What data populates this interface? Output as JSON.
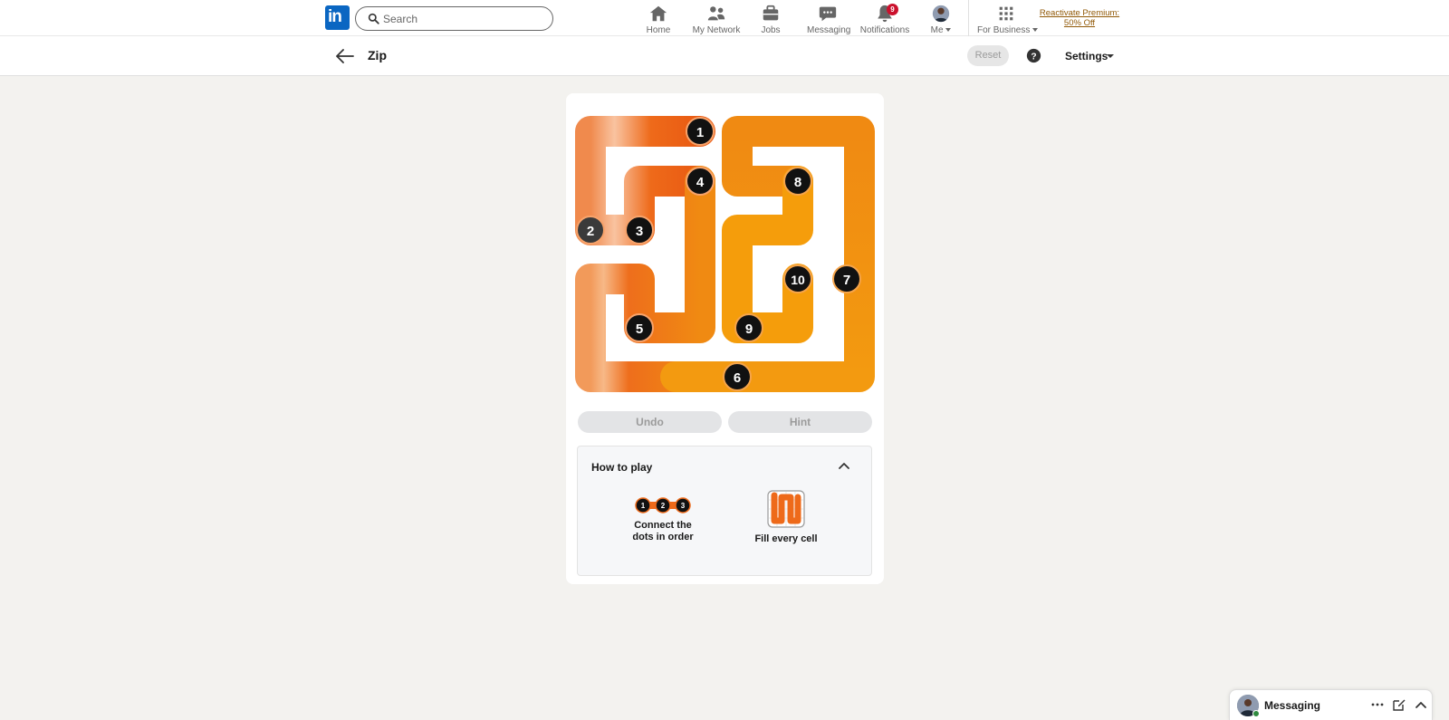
{
  "nav": {
    "logo_text": "in",
    "search_placeholder": "Search",
    "items": [
      {
        "label": "Home",
        "icon": "home-icon"
      },
      {
        "label": "My Network",
        "icon": "network-icon"
      },
      {
        "label": "Jobs",
        "icon": "briefcase-icon"
      },
      {
        "label": "Messaging",
        "icon": "chat-icon"
      },
      {
        "label": "Notifications",
        "icon": "bell-icon",
        "badge": "9"
      },
      {
        "label": "Me",
        "icon": "avatar"
      },
      {
        "label": "For Business",
        "icon": "grid-icon"
      }
    ],
    "premium_line1": "Reactivate Premium:",
    "premium_line2": "50% Off"
  },
  "subheader": {
    "title": "Zip",
    "reset_label": "Reset",
    "settings_label": "Settings"
  },
  "game": {
    "grid_size": "6x6",
    "path_colors": [
      "#f7b08b",
      "#ee6a1a",
      "#f08a12",
      "#f59d0b"
    ],
    "dots": [
      {
        "label": "1",
        "cell": [
          0,
          2
        ]
      },
      {
        "label": "2",
        "cell": [
          2,
          0
        ]
      },
      {
        "label": "3",
        "cell": [
          2,
          1
        ]
      },
      {
        "label": "4",
        "cell": [
          1,
          2
        ]
      },
      {
        "label": "5",
        "cell": [
          4,
          1
        ]
      },
      {
        "label": "6",
        "cell": [
          5,
          3
        ]
      },
      {
        "label": "7",
        "cell": [
          3,
          5
        ]
      },
      {
        "label": "8",
        "cell": [
          1,
          4
        ]
      },
      {
        "label": "9",
        "cell": [
          4,
          3
        ]
      },
      {
        "label": "10",
        "cell": [
          3,
          4
        ]
      }
    ],
    "undo_label": "Undo",
    "hint_label": "Hint",
    "how_to_play": {
      "title": "How to play",
      "step1_line1": "Connect the",
      "step1_line2": "dots in order",
      "step1_dots": [
        "1",
        "2",
        "3"
      ],
      "step2_label": "Fill every cell"
    }
  },
  "messaging_dock": {
    "label": "Messaging"
  }
}
